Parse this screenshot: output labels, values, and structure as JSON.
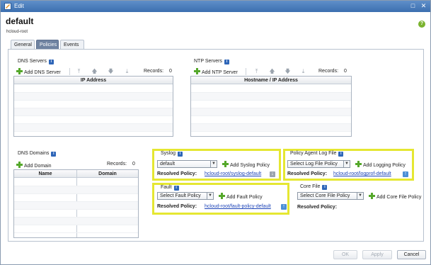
{
  "window": {
    "title": "Edit"
  },
  "header": {
    "title": "default",
    "subtitle": "hcloud-root"
  },
  "tabs": [
    {
      "label": "General",
      "active": false
    },
    {
      "label": "Policies",
      "active": true
    },
    {
      "label": "Events",
      "active": false
    }
  ],
  "dns_servers": {
    "label": "DNS Servers",
    "add_label": "Add DNS Server",
    "records_label": "Records:",
    "records_count": "0",
    "columns": [
      "IP Address"
    ]
  },
  "ntp_servers": {
    "label": "NTP Servers",
    "add_label": "Add NTP Server",
    "records_label": "Records:",
    "records_count": "0",
    "columns": [
      "Hostname / IP Address"
    ]
  },
  "dns_domains": {
    "label": "DNS Domains",
    "add_label": "Add Domain",
    "records_label": "Records:",
    "records_count": "0",
    "columns": [
      "Name",
      "Domain"
    ]
  },
  "syslog": {
    "label": "Syslog",
    "select_value": "default",
    "add_label": "Add Syslog Policy",
    "resolved_label": "Resolved Policy:",
    "resolved_value": "hcloud-root/syslog-default"
  },
  "policy_agent_log": {
    "label": "Policy Agent Log File",
    "select_value": "Select Log File Policy",
    "add_label": "Add Logging Policy",
    "resolved_label": "Resolved Policy:",
    "resolved_value": "hcloud-root/logprof-default"
  },
  "fault": {
    "label": "Fault",
    "select_value": "Select Fault Policy",
    "add_label": "Add Fault Policy",
    "resolved_label": "Resolved Policy:",
    "resolved_value": "hcloud-root/fault-policy-default"
  },
  "core_file": {
    "label": "Core File",
    "select_value": "Select Core File Policy",
    "add_label": "Add Core File Policy",
    "resolved_label": "Resolved Policy:",
    "resolved_value": ""
  },
  "footer": {
    "ok_label": "OK",
    "apply_label": "Apply",
    "cancel_label": "Cancel"
  },
  "colors": {
    "highlight": "#e5e732",
    "titlebar": "#4a7cbd",
    "link": "#1e45b8",
    "add_green": "#55a82b"
  }
}
